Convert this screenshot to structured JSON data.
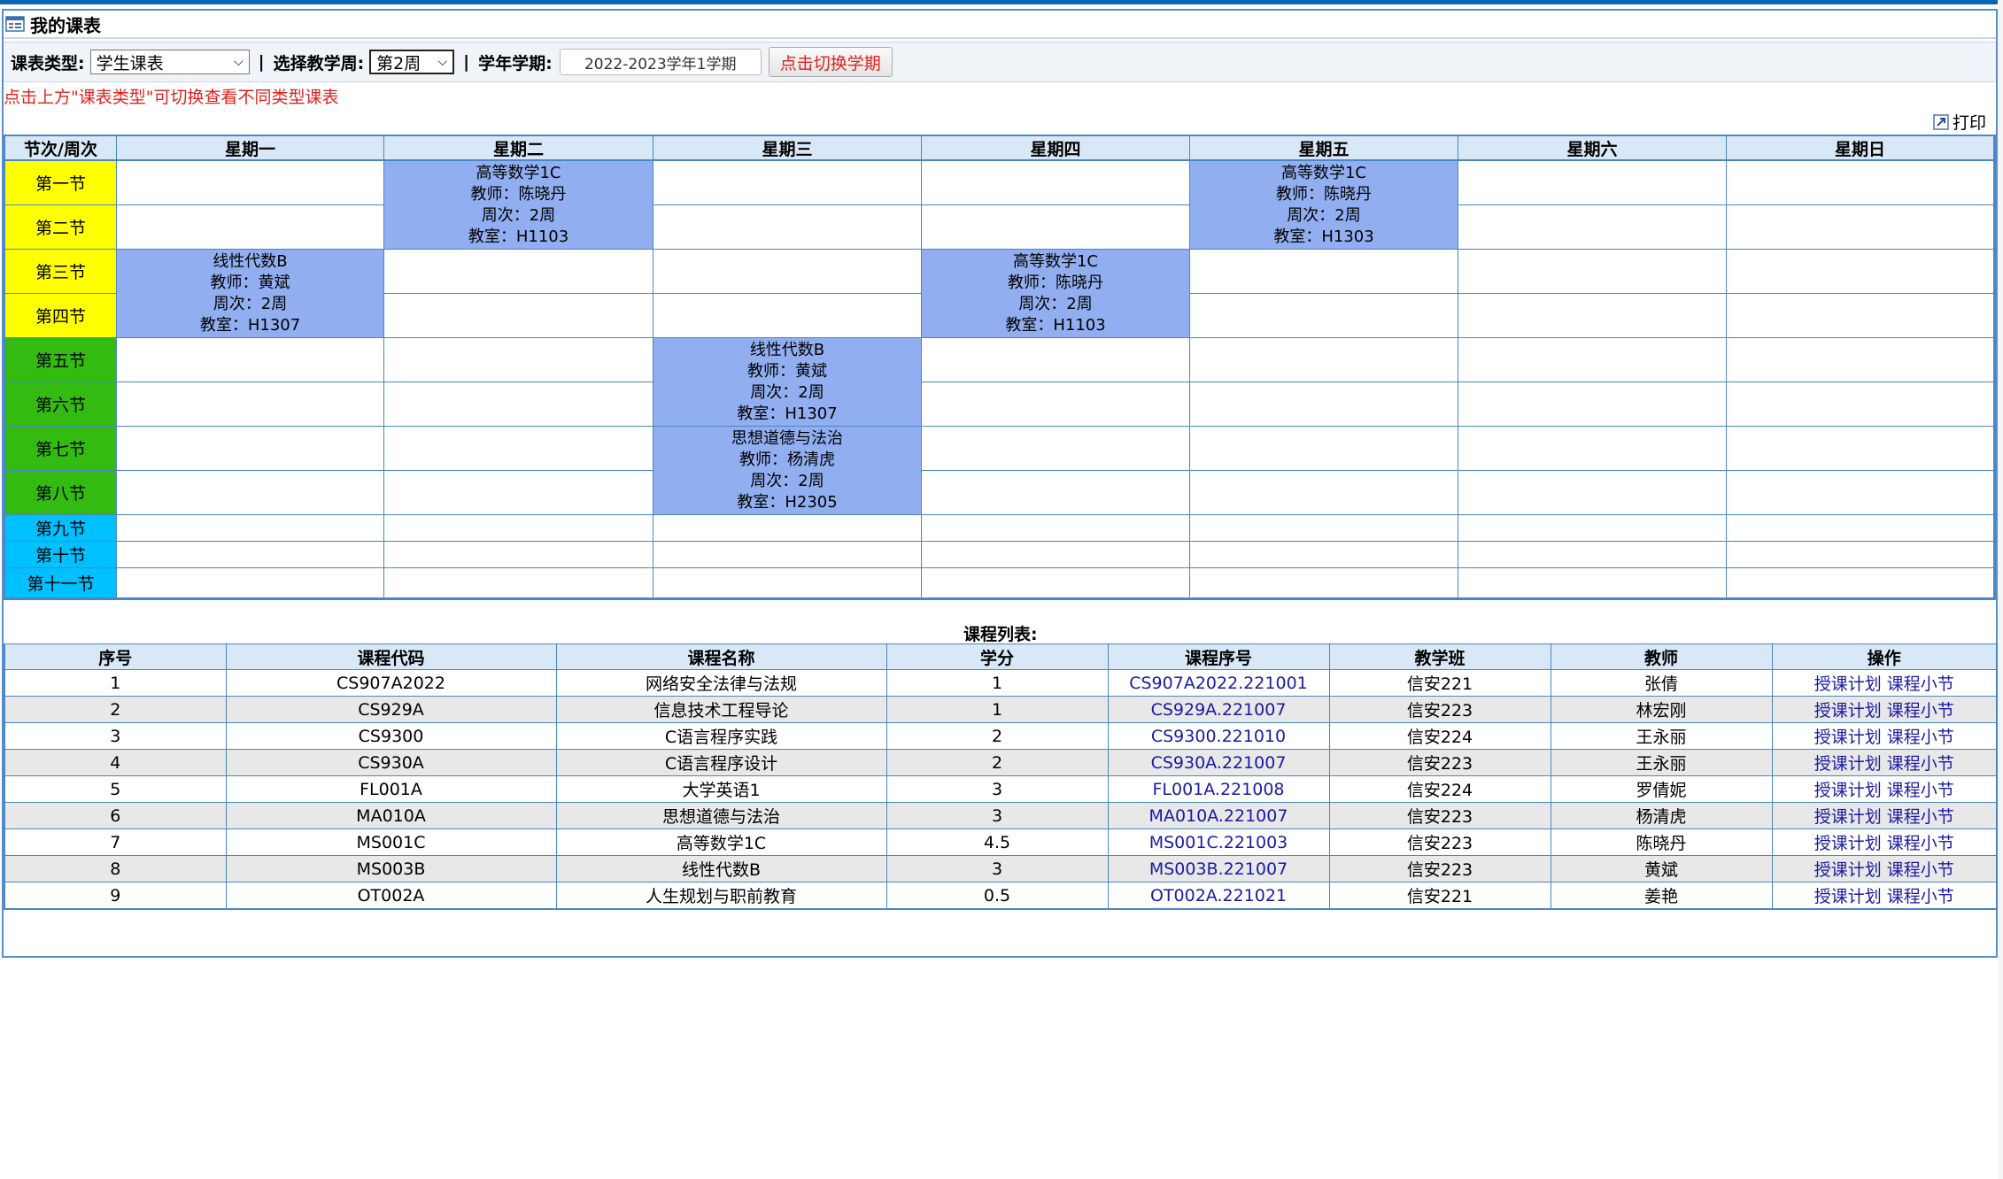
{
  "page": {
    "title": "我的课表"
  },
  "toolbar": {
    "type_label": "课表类型:",
    "type_value": "学生课表",
    "week_label": "选择教学周:",
    "week_value": "第2周",
    "term_label": "学年学期:",
    "term_value": "2022-2023学年1学期",
    "switch_button": "点击切换学期",
    "separator": "|"
  },
  "hint": "点击上方\"课表类型\"可切换查看不同类型课表",
  "print_label": "打印",
  "colors": {
    "period_morning": "#ffff00",
    "period_afternoon": "#33bb11",
    "period_evening": "#00c0ff",
    "course_block": "#91aef0",
    "header_bg": "#d9e8f7",
    "hint_red": "#e0211d"
  },
  "schedule": {
    "corner": "节次/周次",
    "days": [
      "星期一",
      "星期二",
      "星期三",
      "星期四",
      "星期五",
      "星期六",
      "星期日"
    ],
    "periods": [
      "第一节",
      "第二节",
      "第三节",
      "第四节",
      "第五节",
      "第六节",
      "第七节",
      "第八节",
      "第九节",
      "第十节",
      "第十一节"
    ],
    "courses": [
      {
        "name": "高等数学1C",
        "teacher": "教师：陈晓丹",
        "weeks": "周次：2周",
        "room": "教室：H1103"
      },
      {
        "name": "高等数学1C",
        "teacher": "教师：陈晓丹",
        "weeks": "周次：2周",
        "room": "教室：H1303"
      },
      {
        "name": "线性代数B",
        "teacher": "教师：黄斌",
        "weeks": "周次：2周",
        "room": "教室：H1307"
      },
      {
        "name": "高等数学1C",
        "teacher": "教师：陈晓丹",
        "weeks": "周次：2周",
        "room": "教室：H1103"
      },
      {
        "name": "线性代数B",
        "teacher": "教师：黄斌",
        "weeks": "周次：2周",
        "room": "教室：H1307"
      },
      {
        "name": "思想道德与法治",
        "teacher": "教师：杨清虎",
        "weeks": "周次：2周",
        "room": "教室：H2305"
      }
    ]
  },
  "course_list": {
    "title": "课程列表:",
    "headers": [
      "序号",
      "课程代码",
      "课程名称",
      "学分",
      "课程序号",
      "教学班",
      "教师",
      "操作"
    ],
    "action_plan": "授课计划",
    "action_section": "课程小节",
    "rows": [
      [
        "1",
        "CS907A2022",
        "网络安全法律与法规",
        "1",
        "CS907A2022.221001",
        "信安221",
        "张倩"
      ],
      [
        "2",
        "CS929A",
        "信息技术工程导论",
        "1",
        "CS929A.221007",
        "信安223",
        "林宏刚"
      ],
      [
        "3",
        "CS9300",
        "C语言程序实践",
        "2",
        "CS9300.221010",
        "信安224",
        "王永丽"
      ],
      [
        "4",
        "CS930A",
        "C语言程序设计",
        "2",
        "CS930A.221007",
        "信安223",
        "王永丽"
      ],
      [
        "5",
        "FL001A",
        "大学英语1",
        "3",
        "FL001A.221008",
        "信安224",
        "罗倩妮"
      ],
      [
        "6",
        "MA010A",
        "思想道德与法治",
        "3",
        "MA010A.221007",
        "信安223",
        "杨清虎"
      ],
      [
        "7",
        "MS001C",
        "高等数学1C",
        "4.5",
        "MS001C.221003",
        "信安223",
        "陈晓丹"
      ],
      [
        "8",
        "MS003B",
        "线性代数B",
        "3",
        "MS003B.221007",
        "信安223",
        "黄斌"
      ],
      [
        "9",
        "OT002A",
        "人生规划与职前教育",
        "0.5",
        "OT002A.221021",
        "信安221",
        "姜艳"
      ]
    ]
  }
}
